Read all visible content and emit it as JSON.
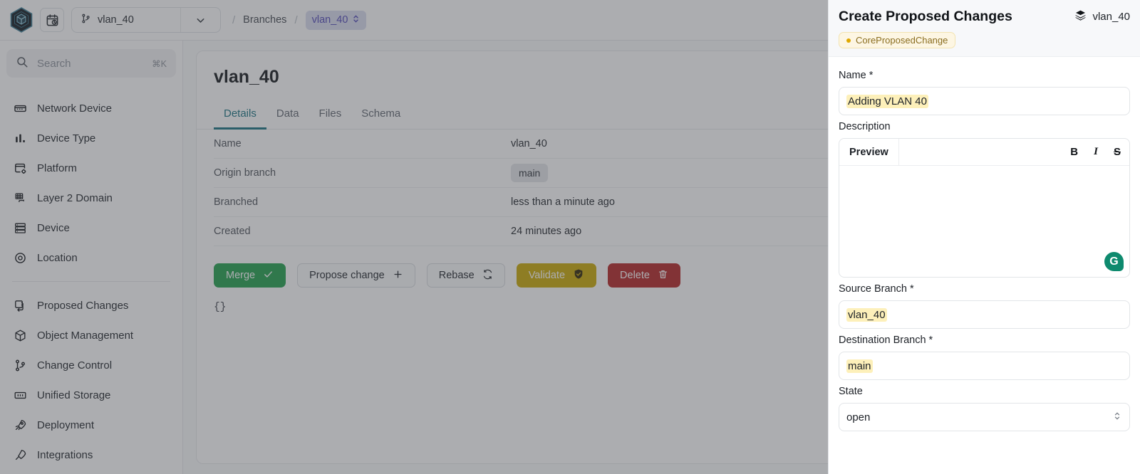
{
  "topbar": {
    "logo_icon": "infrahub-hex-logo",
    "history_icon": "calendar-clock-icon",
    "branch_selector": {
      "icon": "git-branch-icon",
      "value": "vlan_40",
      "caret_icon": "chevron-down-icon"
    },
    "breadcrumb": {
      "sep": "/",
      "items": [
        "Branches",
        "vlan_40"
      ],
      "active_icon": "chevron-up-down-icon"
    }
  },
  "sidebar": {
    "search": {
      "icon": "search-icon",
      "placeholder": "Search",
      "shortcut": "⌘K"
    },
    "items": [
      {
        "label": "Network Device",
        "icon": "server-icon"
      },
      {
        "label": "Device Type",
        "icon": "bar-chart-icon"
      },
      {
        "label": "Platform",
        "icon": "window-settings-icon"
      },
      {
        "label": "Layer 2 Domain",
        "icon": "network-grid-icon"
      },
      {
        "label": "Device",
        "icon": "rack-icon"
      },
      {
        "label": "Location",
        "icon": "target-icon"
      }
    ],
    "items2": [
      {
        "label": "Proposed Changes",
        "icon": "copy-arrow-icon"
      },
      {
        "label": "Object Management",
        "icon": "cube-icon"
      },
      {
        "label": "Change Control",
        "icon": "git-branch-icon"
      },
      {
        "label": "Unified Storage",
        "icon": "storage-icon"
      },
      {
        "label": "Deployment",
        "icon": "rocket-icon"
      },
      {
        "label": "Integrations",
        "icon": "plug-icon"
      }
    ]
  },
  "main": {
    "title": "vlan_40",
    "tabs": [
      {
        "label": "Details",
        "active": true
      },
      {
        "label": "Data",
        "active": false
      },
      {
        "label": "Files",
        "active": false
      },
      {
        "label": "Schema",
        "active": false
      }
    ],
    "details": [
      {
        "label": "Name",
        "value": "vlan_40",
        "chip": false
      },
      {
        "label": "Origin branch",
        "value": "main",
        "chip": true
      },
      {
        "label": "Branched",
        "value": "less than a minute ago",
        "chip": false
      },
      {
        "label": "Created",
        "value": "24 minutes ago",
        "chip": false
      }
    ],
    "buttons": [
      {
        "label": "Merge",
        "icon": "check-icon",
        "style": "merge"
      },
      {
        "label": "Propose change",
        "icon": "plus-icon",
        "style": "neutral"
      },
      {
        "label": "Rebase",
        "icon": "refresh-icon",
        "style": "neutral"
      },
      {
        "label": "Validate",
        "icon": "shield-check-icon",
        "style": "validate"
      },
      {
        "label": "Delete",
        "icon": "trash-icon",
        "style": "delete"
      }
    ],
    "json_preview": "{}"
  },
  "drawer": {
    "title": "Create Proposed Changes",
    "branch_icon": "layers-icon",
    "branch_label": "vlan_40",
    "kind_badge": "CoreProposedChange",
    "name_label": "Name *",
    "name_value": "Adding VLAN 40",
    "description_label": "Description",
    "editor": {
      "tab_label": "Preview",
      "bold": "B",
      "italic": "I",
      "strike": "S",
      "assistant_icon": "grammarly-icon",
      "assistant_glyph": "G"
    },
    "source_branch_label": "Source Branch *",
    "source_branch_value": "vlan_40",
    "destination_branch_label": "Destination Branch *",
    "destination_branch_value": "main",
    "state_label": "State",
    "state_value": "open",
    "state_stepper_icon": "chevron-up-down-icon"
  },
  "colors": {
    "accent_teal": "#14707f",
    "merge_green": "#1e9e4a",
    "validate_gold": "#c9a800",
    "delete_red": "#b32121",
    "badge_yellow": "#e0a800",
    "highlight_yellow": "#fdf0ba",
    "breadcrumb_purple": "#4f46b8"
  }
}
